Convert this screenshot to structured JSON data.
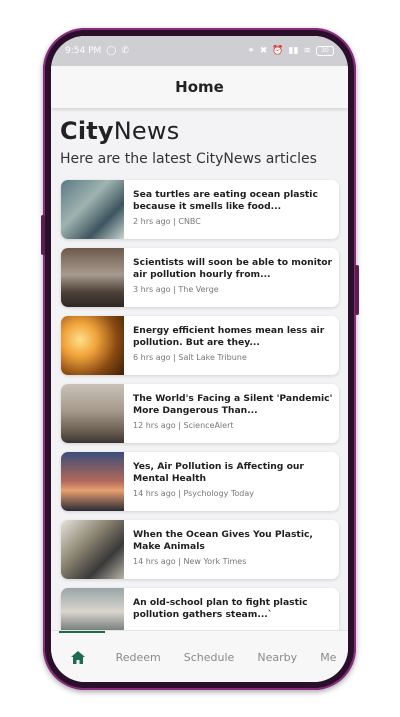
{
  "status_bar": {
    "time": "9:54 PM",
    "battery": "30"
  },
  "header": {
    "title": "Home"
  },
  "brand": {
    "part1": "City",
    "part2": "News"
  },
  "subtitle": "Here are the latest CityNews articles",
  "articles": [
    {
      "headline": "Sea turtles are eating ocean plastic because it smells like food...",
      "meta": "2 hrs ago | CNBC"
    },
    {
      "headline": "Scientists will soon be able to monitor air pollution hourly from...",
      "meta": "3 hrs ago | The Verge"
    },
    {
      "headline": "Energy efficient homes mean less air pollution. But are they...",
      "meta": "6 hrs ago | Salt Lake Tribune"
    },
    {
      "headline": "The World's Facing a Silent 'Pandemic' More Dangerous Than...",
      "meta": "12 hrs ago | ScienceAlert"
    },
    {
      "headline": "Yes, Air Pollution is Affecting our Mental Health",
      "meta": "14 hrs ago | Psychology Today"
    },
    {
      "headline": "When the Ocean Gives You Plastic, Make Animals",
      "meta": "14 hrs ago | New York Times"
    },
    {
      "headline": "An old-school plan to fight plastic pollution gathers steam...`",
      "meta": ""
    }
  ],
  "nav": {
    "home_icon": "home-icon",
    "redeem": "Redeem",
    "schedule": "Schedule",
    "nearby": "Nearby",
    "me": "Me"
  },
  "colors": {
    "accent": "#1e6b52",
    "frame": "#8a2b7e"
  }
}
